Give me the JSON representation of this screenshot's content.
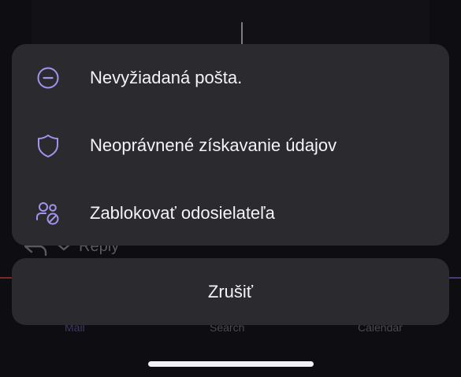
{
  "background": {
    "reply_label": "Reply",
    "tabs": [
      {
        "label": "Mail",
        "icon": "mail-icon"
      },
      {
        "label": "Search",
        "icon": "search-icon"
      },
      {
        "label": "Calendar",
        "icon": "calendar-icon"
      }
    ]
  },
  "action_sheet": {
    "items": [
      {
        "label": "Nevyžiadaná pošta.",
        "icon": "minus-circle-icon"
      },
      {
        "label": "Neoprávnené získavanie údajov",
        "icon": "shield-icon"
      },
      {
        "label": "Zablokovať odosielateľa",
        "icon": "block-sender-icon"
      }
    ],
    "cancel_label": "Zrušiť"
  },
  "colors": {
    "accent": "#a493ef",
    "sheet_bg": "#2b2a2f",
    "text": "#f4f4f6"
  }
}
